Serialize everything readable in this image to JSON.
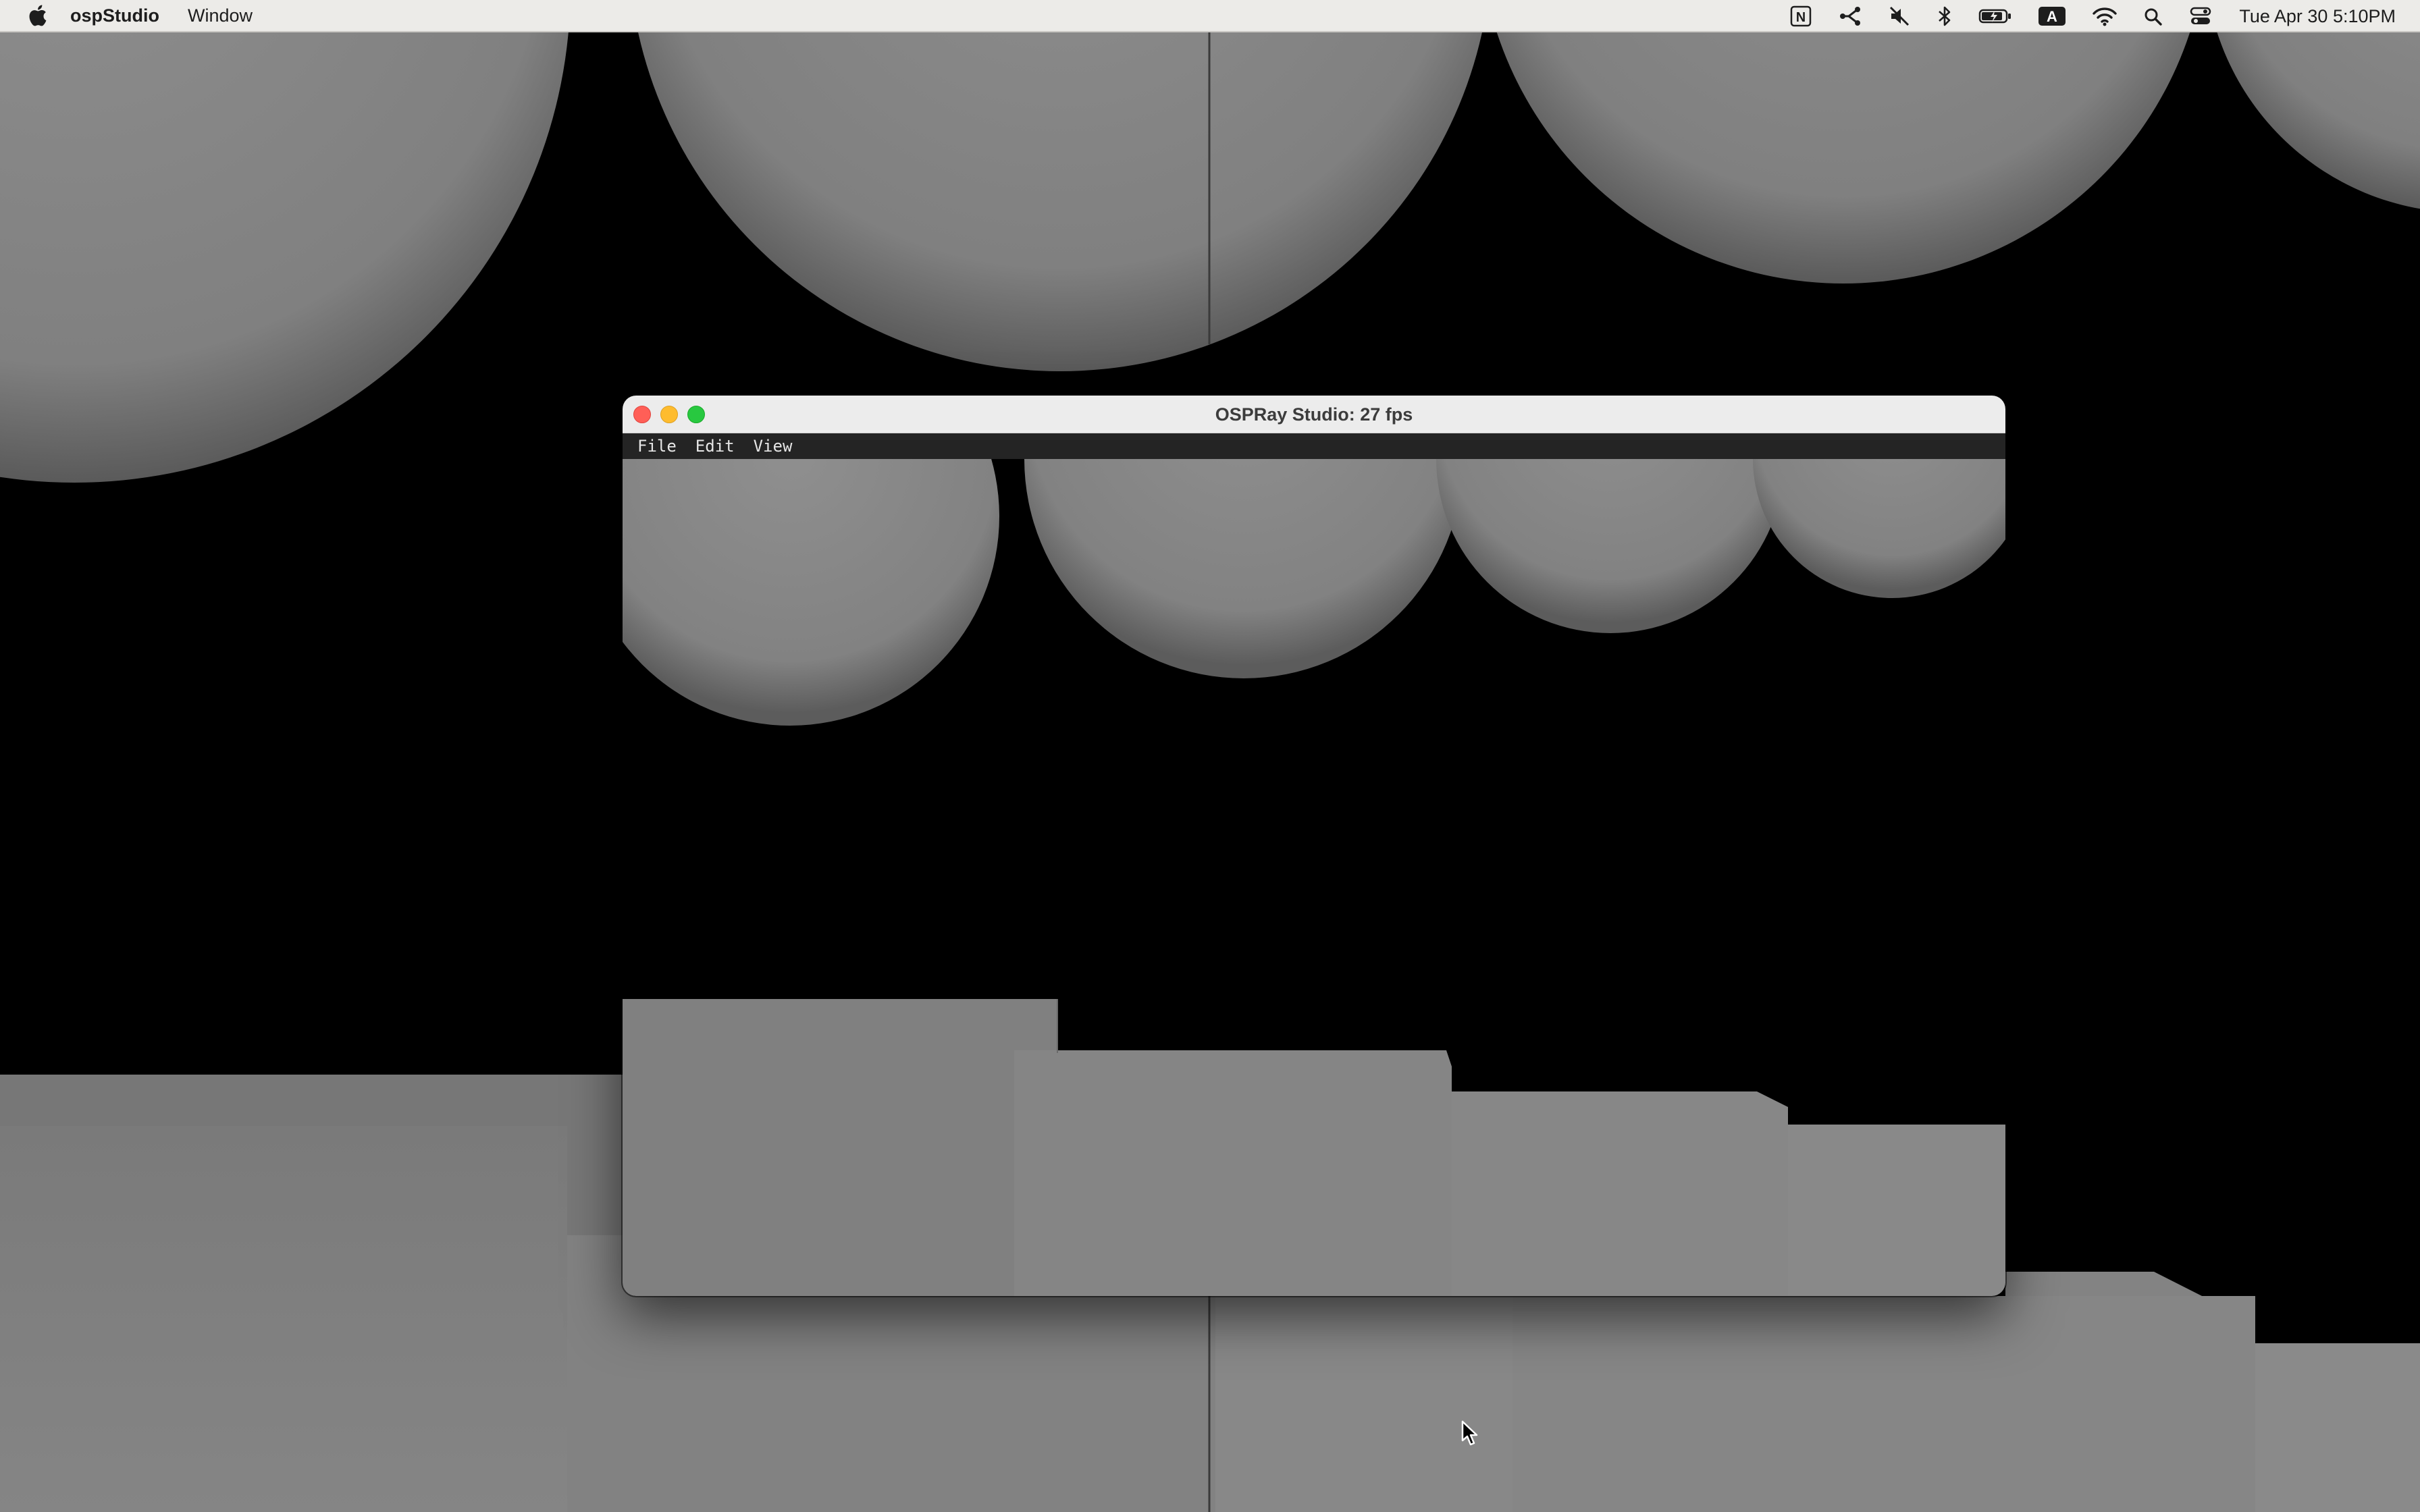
{
  "menubar": {
    "app_name": "ospStudio",
    "items": [
      "Window"
    ],
    "status_icons": [
      "notion-icon",
      "route-icon",
      "mute-icon",
      "bluetooth-icon",
      "battery-charging-icon",
      "input-source-icon",
      "wifi-icon",
      "spotlight-search-icon",
      "control-center-icon"
    ],
    "input_source_label": "A",
    "notion_label": "N",
    "clock": "Tue Apr 30  5:10PM"
  },
  "window": {
    "title": "OSPRay Studio: 27 fps",
    "menu": [
      "File",
      "Edit",
      "View"
    ]
  },
  "colors": {
    "menubar_bg": "#ecebe8",
    "scene_bg": "#000000",
    "object_gray": "#8a8a8a",
    "imgui_menubar_bg": "#242424",
    "close": "#ff5f57",
    "minimize": "#febc2e",
    "maximize": "#28c840"
  }
}
